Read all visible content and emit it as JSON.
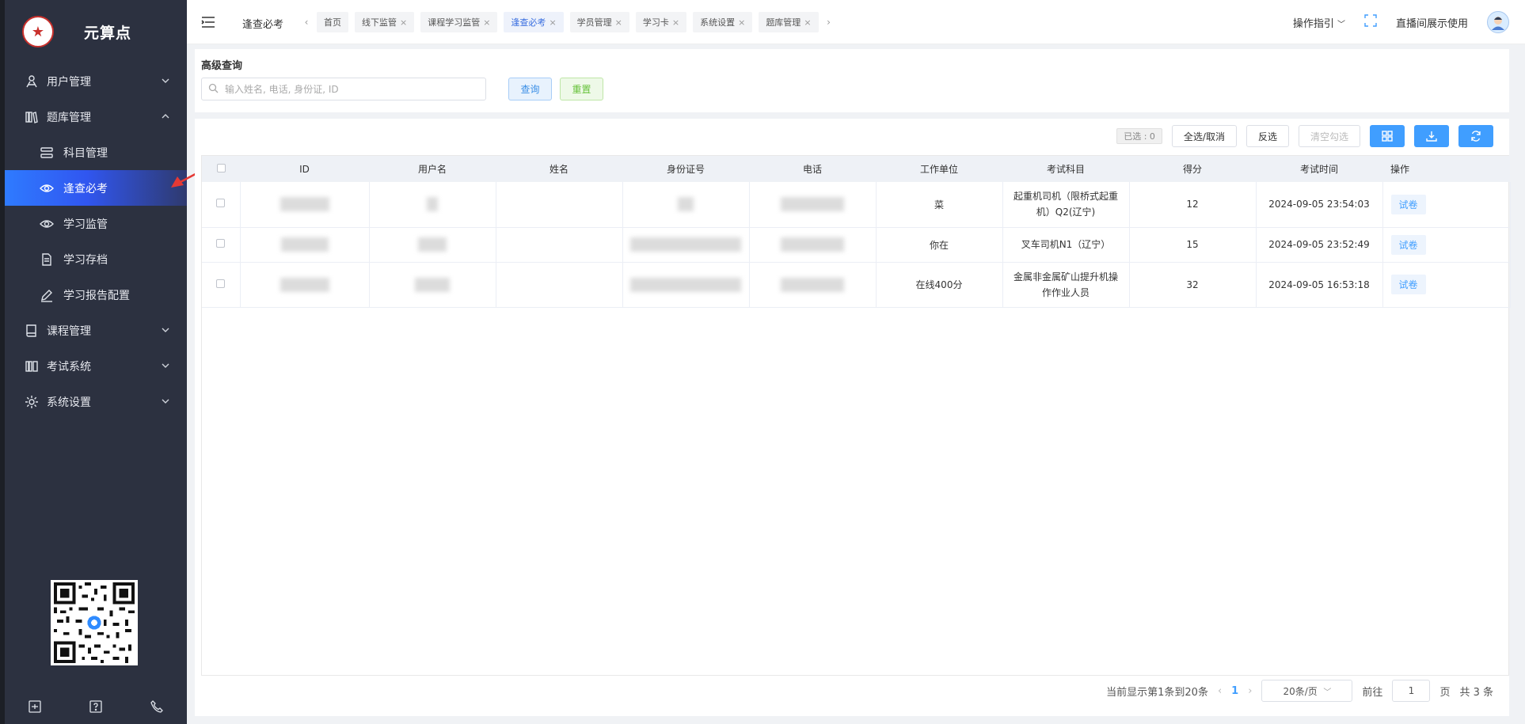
{
  "brand": {
    "name": "元算点"
  },
  "sidebar": {
    "items": [
      {
        "label": "用户管理",
        "icon": "user-icon"
      },
      {
        "label": "题库管理",
        "icon": "library-icon",
        "expanded": true,
        "children": [
          {
            "label": "科目管理",
            "icon": "subject-icon"
          },
          {
            "label": "逢查必考",
            "icon": "eye-icon",
            "active": true
          },
          {
            "label": "学习监管",
            "icon": "eye-icon"
          },
          {
            "label": "学习存档",
            "icon": "document-icon"
          },
          {
            "label": "学习报告配置",
            "icon": "pen-icon"
          }
        ]
      },
      {
        "label": "课程管理",
        "icon": "book-icon"
      },
      {
        "label": "考试系统",
        "icon": "exam-icon"
      },
      {
        "label": "系统设置",
        "icon": "gear-icon"
      }
    ]
  },
  "header": {
    "breadcrumb": "逢查必考",
    "tabs": [
      {
        "label": "首页",
        "closable": false
      },
      {
        "label": "线下监管"
      },
      {
        "label": "课程学习监管"
      },
      {
        "label": "逢查必考",
        "active": true
      },
      {
        "label": "学员管理"
      },
      {
        "label": "学习卡"
      },
      {
        "label": "系统设置"
      },
      {
        "label": "题库管理"
      }
    ],
    "guide": "操作指引",
    "user": "直播间展示使用"
  },
  "filter": {
    "title": "高级查询",
    "placeholder": "输入姓名, 电话, 身份证, ID",
    "query_label": "查询",
    "reset_label": "重置"
  },
  "toolbar": {
    "selected": "已选 : 0",
    "select_all": "全选/取消",
    "invert": "反选",
    "clear": "清空勾选"
  },
  "table": {
    "columns": [
      "ID",
      "用户名",
      "姓名",
      "身份证号",
      "电话",
      "工作单位",
      "考试科目",
      "得分",
      "考试时间",
      "操作"
    ],
    "rows": [
      {
        "unit": "菜",
        "subject": "起重机司机（限桥式起重机）Q2(辽宁)",
        "score": "12",
        "time": "2024-09-05 23:54:03",
        "action": "试卷"
      },
      {
        "unit": "你在",
        "subject": "叉车司机N1（辽宁）",
        "score": "15",
        "time": "2024-09-05 23:52:49",
        "action": "试卷"
      },
      {
        "unit": "在线400分",
        "subject": "金属非金属矿山提升机操作作业人员",
        "score": "32",
        "time": "2024-09-05 16:53:18",
        "action": "试卷"
      }
    ]
  },
  "pagination": {
    "summary": "当前显示第1条到20条",
    "current": "1",
    "page_size": "20条/页",
    "goto": "前往",
    "goto_value": "1",
    "page_unit": "页",
    "total": "共 3 条"
  },
  "colors": {
    "accent": "#409eff",
    "sidebar_bg": "#2c3140",
    "active_item": "#2f7bff",
    "annotation_arrow": "#e53935"
  }
}
